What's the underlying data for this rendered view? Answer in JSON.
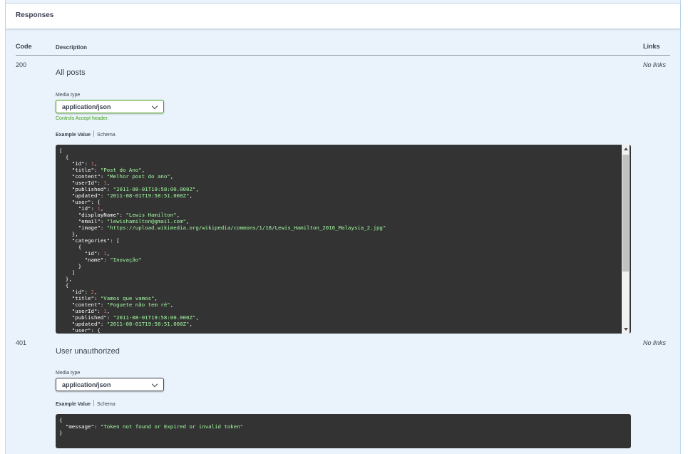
{
  "panel": {
    "title": "Responses"
  },
  "columns": {
    "code": "Code",
    "description": "Description",
    "links": "Links"
  },
  "responses": [
    {
      "code": "200",
      "description": "All posts",
      "links": "No links",
      "media_type_label": "Media type",
      "media_type": "application/json",
      "controls_text": "Controls Accept header.",
      "tab_example": "Example Value",
      "tab_schema": "Schema"
    },
    {
      "code": "401",
      "description": "User unauthorized",
      "links": "No links",
      "media_type_label": "Media type",
      "media_type": "application/json",
      "tab_example": "Example Value",
      "tab_schema": "Schema"
    }
  ],
  "example_200": [
    {
      "t": "["
    },
    {
      "t": "  {"
    },
    {
      "k": "\"id\"",
      "v": "1",
      "type": "n"
    },
    {
      "k": "\"title\"",
      "v": "\"Post do Ano\"",
      "type": "s"
    },
    {
      "k": "\"content\"",
      "v": "\"Melhor post do ano\"",
      "type": "s"
    },
    {
      "k": "\"userId\"",
      "v": "1",
      "type": "n"
    },
    {
      "k": "\"published\"",
      "v": "\"2011-08-01T19:58:00.000Z\"",
      "type": "s"
    },
    {
      "k": "\"updated\"",
      "v": "\"2011-08-01T19:58:51.000Z\"",
      "type": "s"
    },
    {
      "t": "    \"user\": {"
    },
    {
      "k": "  \"id\"",
      "v": "1",
      "type": "n"
    },
    {
      "k": "  \"displayName\"",
      "v": "\"Lewis Hamilton\"",
      "type": "s"
    },
    {
      "k": "  \"email\"",
      "v": "\"lewishamilton@gmail.com\"",
      "type": "s"
    },
    {
      "k": "  \"image\"",
      "v": "\"https://upload.wikimedia.org/wikipedia/commons/1/18/Lewis_Hamilton_2016_Malaysia_2.jpg\"",
      "type": "s",
      "last": true
    },
    {
      "t": "    },"
    },
    {
      "t": "    \"categories\": ["
    },
    {
      "t": "      {"
    },
    {
      "k": "    \"id\"",
      "v": "1",
      "type": "n"
    },
    {
      "k": "    \"name\"",
      "v": "\"Inovação\"",
      "type": "s",
      "last": true
    },
    {
      "t": "      }"
    },
    {
      "t": "    ]"
    },
    {
      "t": "  },"
    },
    {
      "t": "  {"
    },
    {
      "k": "\"id\"",
      "v": "2",
      "type": "n"
    },
    {
      "k": "\"title\"",
      "v": "\"Vamos que vamos\"",
      "type": "s"
    },
    {
      "k": "\"content\"",
      "v": "\"Foguete não tem ré\"",
      "type": "s"
    },
    {
      "k": "\"userId\"",
      "v": "1",
      "type": "n"
    },
    {
      "k": "\"published\"",
      "v": "\"2011-08-01T19:58:00.000Z\"",
      "type": "s"
    },
    {
      "k": "\"updated\"",
      "v": "\"2011-08-01T19:58:51.000Z\"",
      "type": "s"
    },
    {
      "t": "    \"user\": {"
    }
  ],
  "example_401": [
    {
      "t": "{"
    },
    {
      "k": "\"message\"",
      "v": "\"Token not found or Expired or invalid token\"",
      "type": "s",
      "last": true,
      "indent": "  "
    },
    {
      "t": "}"
    }
  ],
  "colors": {
    "panel_bg": "#eaf3fb",
    "accent_green": "#41a017",
    "code_bg": "#333333",
    "string": "#a2fca2",
    "number": "#d36363"
  },
  "icons": [
    "chevron-down-icon",
    "scroll-up-arrow-icon",
    "scroll-down-arrow-icon"
  ]
}
